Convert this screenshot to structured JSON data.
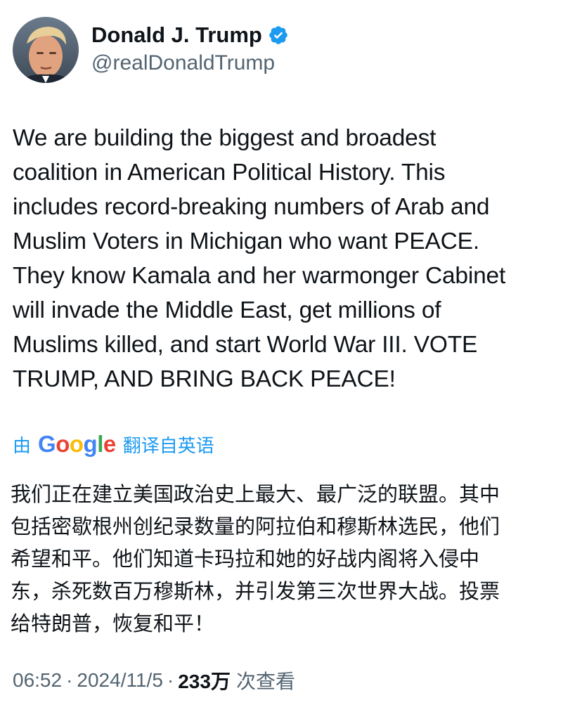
{
  "author": {
    "display_name": "Donald J. Trump",
    "handle": "@realDonaldTrump",
    "verified": true,
    "avatar_icon": "profile-photo",
    "verified_color": "#1d9bf0"
  },
  "tweet": {
    "lines": [
      "We are building the biggest and broadest",
      "coalition in American Political History. This",
      "includes record-breaking numbers of Arab and",
      "Muslim Voters in Michigan who want PEACE.",
      "They know Kamala and her warmonger Cabinet",
      "will invade the Middle East, get millions of",
      "Muslims killed, and start World War III. VOTE",
      "TRUMP, AND BRING BACK PEACE!"
    ]
  },
  "translation": {
    "prefix": "由",
    "provider": "Google",
    "suffix": "翻译自英语",
    "lines": [
      "我们正在建立美国政治史上最大、最广泛的联盟。其中",
      "包括密歇根州创纪录数量的阿拉伯和穆斯林选民，他们",
      "希望和平。他们知道卡玛拉和她的好战内阁将入侵中",
      "东，杀死数百万穆斯林，并引发第三次世界大战。投票",
      "给特朗普，恢复和平！"
    ]
  },
  "meta": {
    "time": "06:52",
    "separator": "·",
    "date": "2024/11/5",
    "views_count": "233万",
    "views_label": "次查看"
  },
  "colors": {
    "accent": "#1d9bf0",
    "text_primary": "#0f1419",
    "text_secondary": "#536471"
  }
}
